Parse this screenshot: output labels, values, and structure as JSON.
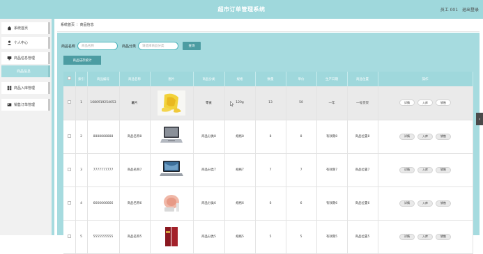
{
  "header": {
    "title": "超市订单管理系统",
    "user": "员工 001",
    "logout": "退出登录"
  },
  "sidebar": {
    "items": [
      {
        "label": "系统首页",
        "icon": "home-icon"
      },
      {
        "label": "个人中心",
        "icon": "person-icon"
      },
      {
        "label": "商品信息管理",
        "icon": "monitor-icon"
      },
      {
        "label": "商品信息",
        "icon": ""
      },
      {
        "label": "商品入库管理",
        "icon": "grid-icon"
      },
      {
        "label": "销售订单管理",
        "icon": "card-icon"
      }
    ]
  },
  "breadcrumb": {
    "home": "系统首页",
    "current": "商品信息"
  },
  "search": {
    "name_label": "商品名称",
    "name_placeholder": "商品名称",
    "category_label": "商品分类",
    "category_placeholder": "请选择商品分类",
    "search_button": "查询"
  },
  "stats_button": "商品成存统计",
  "table": {
    "headers": [
      "",
      "索引",
      "商品编号",
      "商品名称",
      "图片",
      "商品分类",
      "规格",
      "数量",
      "单价",
      "生产日期",
      "商品位置",
      "操作"
    ],
    "op_labels": {
      "detail": "详情",
      "stock_in": "入库",
      "sale": "销售"
    },
    "rows": [
      {
        "index": "1",
        "code": "1680919254053",
        "name": "薯片",
        "image": "chips-bag-image",
        "category": "零食",
        "spec": "120g",
        "qty": "13",
        "price": "50",
        "date": "一年",
        "location": "一号货架",
        "highlight": true
      },
      {
        "index": "2",
        "code": "8888888888",
        "name": "商品名称8",
        "image": "laptop-image",
        "category": "商品分类8",
        "spec": "规格8",
        "qty": "8",
        "price": "8",
        "date": "有效期8",
        "location": "商品位置8",
        "highlight": false
      },
      {
        "index": "3",
        "code": "7777777777",
        "name": "商品名称7",
        "image": "laptop-image",
        "category": "商品分类7",
        "spec": "规格7",
        "qty": "7",
        "price": "7",
        "date": "有效期7",
        "location": "商品位置7",
        "highlight": false
      },
      {
        "index": "4",
        "code": "6666666666",
        "name": "商品名称6",
        "image": "cosmetics-image",
        "category": "商品分类6",
        "spec": "规格6",
        "qty": "6",
        "price": "6",
        "date": "有效期6",
        "location": "商品位置6",
        "highlight": false
      },
      {
        "index": "5",
        "code": "5555555555",
        "name": "商品名称5",
        "image": "wine-box-image",
        "category": "商品分类5",
        "spec": "规格5",
        "qty": "5",
        "price": "5",
        "date": "有效期5",
        "location": "商品位置5",
        "highlight": false
      }
    ]
  },
  "colors": {
    "accent": "#9fd8dc",
    "button": "#4c9ca2",
    "content_bg": "#a6dbdf"
  }
}
